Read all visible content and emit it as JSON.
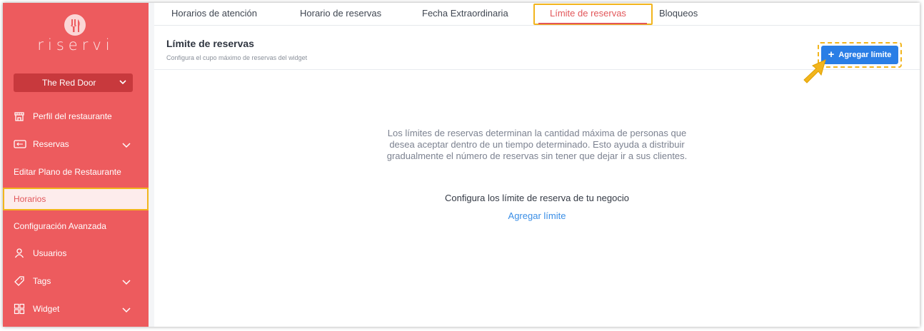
{
  "brand": {
    "name": "riservi"
  },
  "venue": {
    "selected": "The Red Door"
  },
  "sidebar": {
    "items": [
      {
        "label": "Perfil del restaurante",
        "icon": "store-icon"
      },
      {
        "label": "Reservas",
        "icon": "reservation-card-icon",
        "expandable": true
      },
      {
        "label": "Editar Plano de Restaurante"
      },
      {
        "label": "Horarios",
        "active": true
      },
      {
        "label": "Configuración Avanzada"
      },
      {
        "label": "Usuarios",
        "icon": "user-icon"
      },
      {
        "label": "Tags",
        "icon": "tag-icon",
        "expandable": true
      },
      {
        "label": "Widget",
        "icon": "widget-grid-icon",
        "expandable": true
      }
    ]
  },
  "tabs": [
    {
      "label": "Horarios de atención"
    },
    {
      "label": "Horario de reservas"
    },
    {
      "label": "Fecha Extraordinaria"
    },
    {
      "label": "Límite de reservas",
      "active": true
    },
    {
      "label": "Bloqueos"
    }
  ],
  "header": {
    "title": "Límite de reservas",
    "subtitle": "Configura el cupo máximo de reservas del widget",
    "add_button_label": "Agregar límite"
  },
  "empty_state": {
    "description": "Los límites de reservas determinan la cantidad máxima de personas que desea aceptar dentro de un tiempo determinado. Esto ayuda a distribuir gradualmente el número de reservas sin tener que dejar ir a sus clientes.",
    "cta_text": "Configura los límite de reserva de tu negocio",
    "cta_link": "Agregar límite"
  },
  "colors": {
    "sidebar": "#ed5b5e",
    "accent": "#e2575a",
    "primary_button": "#2a7ee6",
    "highlight": "#f2b51d",
    "link": "#3a8ee6"
  }
}
